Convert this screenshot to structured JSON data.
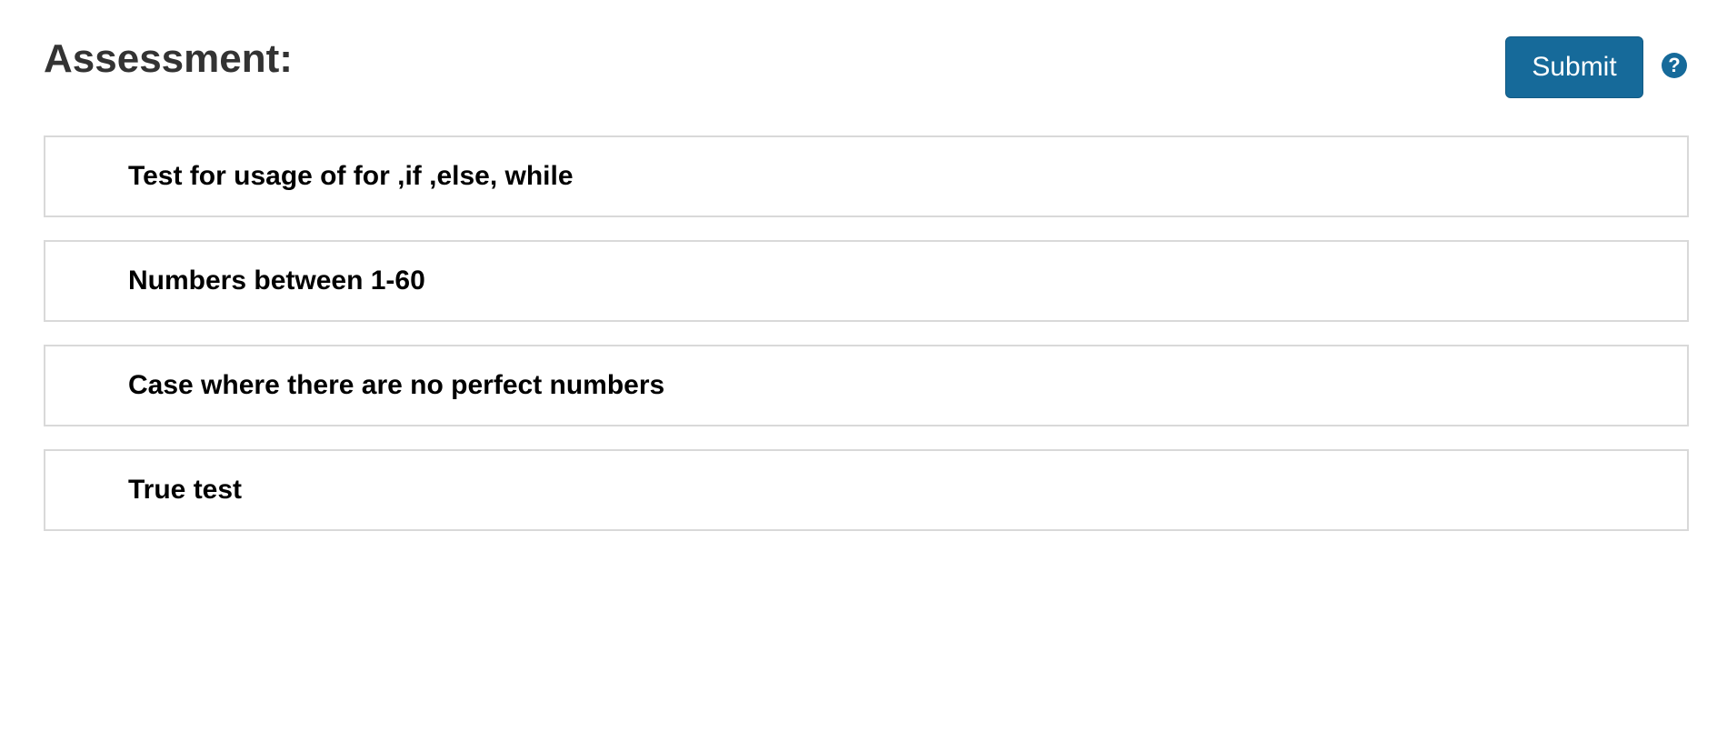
{
  "header": {
    "title": "Assessment:",
    "submit_label": "Submit",
    "help_icon": "question-circle-icon",
    "help_glyph": "?"
  },
  "colors": {
    "accent": "#166a9a",
    "title_text": "#333333",
    "item_border": "#d9d9d9"
  },
  "tests": [
    {
      "label": "Test for usage of for ,if ,else, while"
    },
    {
      "label": "Numbers between 1-60"
    },
    {
      "label": "Case where there are no perfect numbers"
    },
    {
      "label": "True test"
    }
  ]
}
